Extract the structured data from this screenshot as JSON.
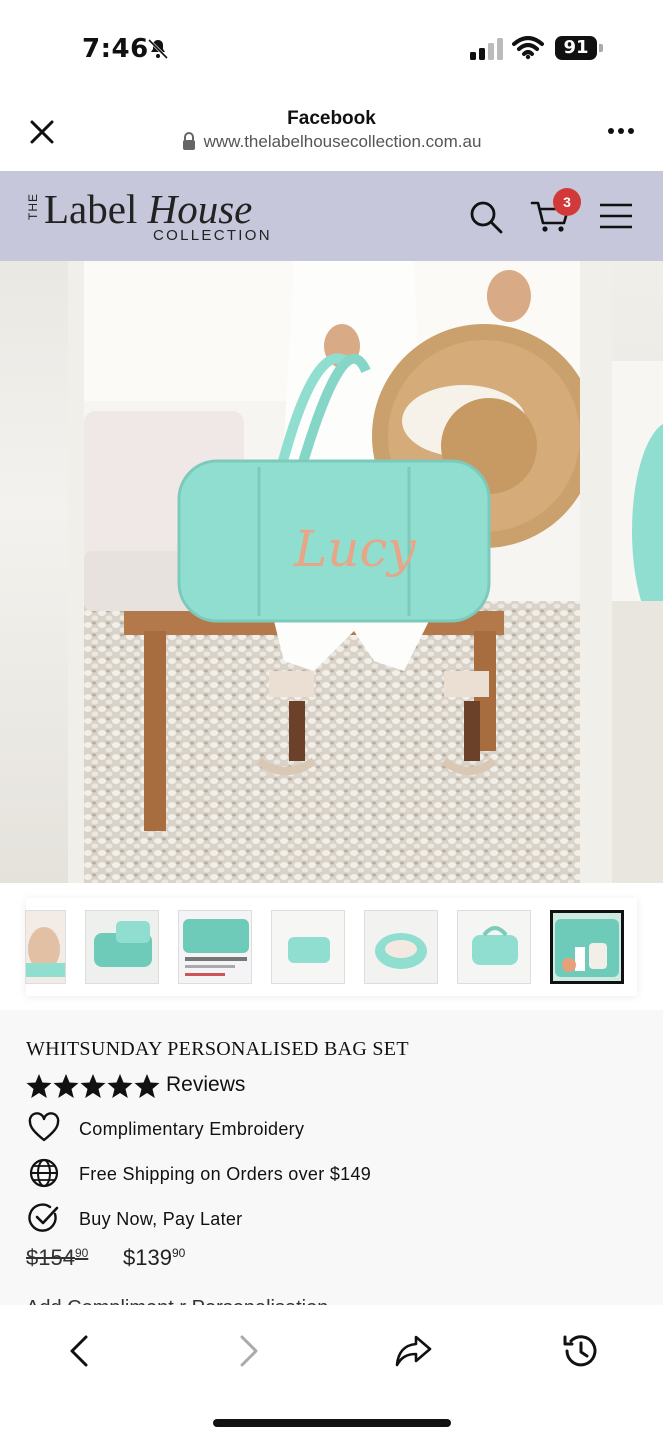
{
  "status_bar": {
    "time": "7:46",
    "battery": "91",
    "icons": [
      "bell-slash-icon",
      "signal-icon",
      "wifi-icon",
      "battery-icon"
    ]
  },
  "browser": {
    "title": "Facebook",
    "url": "www.thelabelhousecollection.com.au",
    "icons": [
      "close-icon",
      "lock-icon",
      "more-icon"
    ]
  },
  "site_nav": {
    "logo": {
      "the": "THE",
      "label": "Label",
      "house": "House",
      "collection": "COLLECTION"
    },
    "cart_count": "3",
    "icons": [
      "search-icon",
      "cart-icon",
      "menu-icon"
    ],
    "background": "#c6c7db"
  },
  "gallery": {
    "main_image_text": "Lucy",
    "thumbnail_count": 7,
    "active_thumbnail_index": 6
  },
  "product": {
    "title": "WHITSUNDAY PERSONALISED BAG SET",
    "rating_stars": 5,
    "reviews_label": "Reviews",
    "features": [
      {
        "icon": "heart-icon",
        "label": "Complimentary Embroidery"
      },
      {
        "icon": "globe-icon",
        "label": "Free Shipping on Orders over $149"
      },
      {
        "icon": "check-circle-icon",
        "label": "Buy Now, Pay Later"
      }
    ],
    "price_old": "$154",
    "price_old_cents": "90",
    "price_new": "$139",
    "price_new_cents": "90",
    "next_section_partial": "Add Compliment  r Personalisation"
  },
  "toolbar": {
    "icons": [
      "back-icon",
      "forward-icon",
      "share-icon",
      "history-icon"
    ]
  },
  "colors": {
    "nav_bg": "#c6c7db",
    "bag_mint": "#8fded0",
    "badge_red": "#d23a3a"
  }
}
